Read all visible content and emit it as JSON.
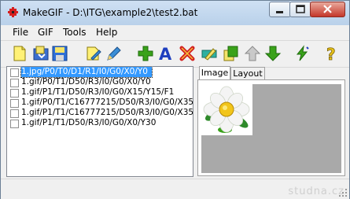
{
  "window": {
    "title": "MakeGIF - D:\\ITG\\example2\\test2.bat"
  },
  "menu": [
    "File",
    "GIF",
    "Tools",
    "Help"
  ],
  "toolbar": {
    "buttons": [
      "new-file",
      "open-file",
      "save-file",
      "edit-file",
      "edit-pen",
      "add-item",
      "add-text",
      "delete-item",
      "edit-item",
      "copy-item",
      "move-up",
      "move-down",
      "run",
      "help"
    ]
  },
  "list": {
    "rows": [
      {
        "text": "1.jpg/P0/T0/D1/R1/I0/G0/X0/Y0",
        "checked": false,
        "selected": true
      },
      {
        "text": "1.gif/P0/T1/D50/R3/I0/G0/X0/Y0",
        "checked": false,
        "selected": false
      },
      {
        "text": "1.gif/P1/T1/D50/R3/I0/G0/X15/Y15/F1",
        "checked": false,
        "selected": false
      },
      {
        "text": "1.gif/P0/T1/C16777215/D50/R3/I0/G0/X35",
        "checked": false,
        "selected": false
      },
      {
        "text": "1.gif/P1/T1/C16777215/D50/R3/I0/G0/X35",
        "checked": false,
        "selected": false
      },
      {
        "text": "1.gif/P1/T1/D50/R3/I0/G0/X0/Y30",
        "checked": false,
        "selected": false
      }
    ]
  },
  "tabs": [
    {
      "label": "Image",
      "active": true
    },
    {
      "label": "Layout",
      "active": false
    }
  ],
  "status": {
    "watermark": "studna.cz"
  },
  "colors": {
    "selection": "#3399ff",
    "canvas": "#a9a9a9",
    "add_green": "#3aa21a",
    "text_blue": "#1f3fbf",
    "delete_red": "#d21f1f"
  }
}
